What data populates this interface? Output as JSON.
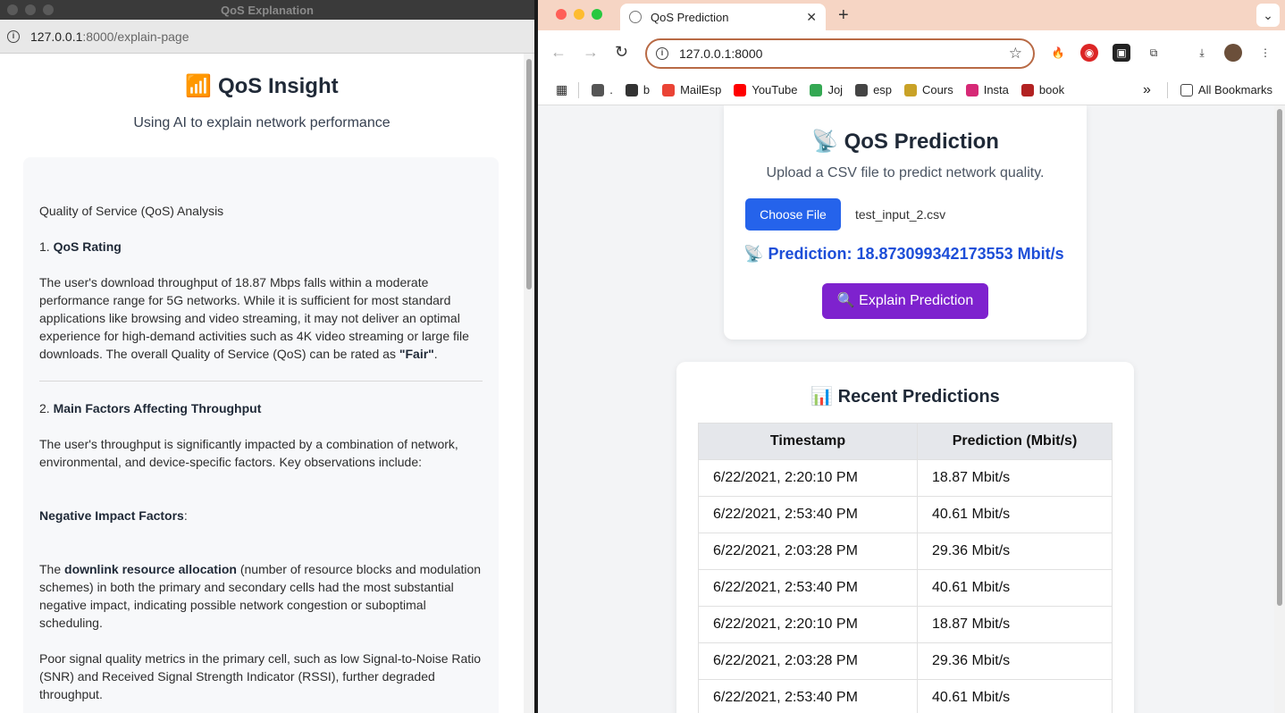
{
  "left_window": {
    "title": "QoS Explanation",
    "url_host": "127.0.0.1",
    "url_path": ":8000/explain-page",
    "heading_icon": "📶",
    "heading": "QoS Insight",
    "subheading": "Using AI to explain network performance",
    "report": {
      "title": "Quality of Service (QoS) Analysis",
      "s1_num": "1. ",
      "s1_title": "QoS Rating",
      "s1_text": "The user's download throughput of 18.87 Mbps falls within a moderate performance range for 5G networks. While it is sufficient for most standard applications like browsing and video streaming, it may not deliver an optimal experience for high-demand activities such as 4K video streaming or large file downloads. The overall Quality of Service (QoS) can be rated as ",
      "s1_rating": "\"Fair\"",
      "s1_end": ".",
      "s2_num": "2. ",
      "s2_title": "Main Factors Affecting Throughput",
      "s2_text": "The user's throughput is significantly impacted by a combination of network, environmental, and device-specific factors. Key observations include:",
      "neg_title": "Negative Impact Factors",
      "neg_colon": ":",
      "p1_pre": "The ",
      "p1_bold": "downlink resource allocation",
      "p1_text": " (number of resource blocks and modulation schemes) in both the primary and secondary cells had the most substantial negative impact, indicating possible network congestion or suboptimal scheduling.",
      "p2_text": "Poor signal quality metrics in the primary cell, such as low Signal-to-Noise Ratio (SNR) and Received Signal Strength Indicator (RSSI), further degraded throughput."
    }
  },
  "right_window": {
    "tab_title": "QoS Prediction",
    "url": "127.0.0.1:8000",
    "bookmarks": [
      {
        "label": ".",
        "color": "#555555"
      },
      {
        "label": "b",
        "color": "#333333"
      },
      {
        "label": "MailEsp",
        "color": "#ea4335"
      },
      {
        "label": "YouTube",
        "color": "#ff0000"
      },
      {
        "label": "Joj",
        "color": "#34a853"
      },
      {
        "label": "esp",
        "color": "#444444"
      },
      {
        "label": "Cours",
        "color": "#c9a227"
      },
      {
        "label": "Insta",
        "color": "#d62976"
      },
      {
        "label": "book",
        "color": "#b22222"
      }
    ],
    "more_bookmarks": "»",
    "all_bookmarks": "All Bookmarks",
    "card": {
      "title_icon": "📡",
      "title": "QoS Prediction",
      "subtitle": "Upload a CSV file to predict network quality.",
      "choose_file": "Choose File",
      "file_name": "test_input_2.csv",
      "prediction_icon": "📡",
      "prediction": "Prediction: 18.873099342173553 Mbit/s",
      "explain_icon": "🔍",
      "explain_label": "Explain Prediction"
    },
    "recent": {
      "title_icon": "📊",
      "title": "Recent Predictions",
      "columns": [
        "Timestamp",
        "Prediction (Mbit/s)"
      ],
      "rows": [
        [
          "6/22/2021, 2:20:10 PM",
          "18.87 Mbit/s"
        ],
        [
          "6/22/2021, 2:53:40 PM",
          "40.61 Mbit/s"
        ],
        [
          "6/22/2021, 2:03:28 PM",
          "29.36 Mbit/s"
        ],
        [
          "6/22/2021, 2:53:40 PM",
          "40.61 Mbit/s"
        ],
        [
          "6/22/2021, 2:20:10 PM",
          "18.87 Mbit/s"
        ],
        [
          "6/22/2021, 2:03:28 PM",
          "29.36 Mbit/s"
        ],
        [
          "6/22/2021, 2:53:40 PM",
          "40.61 Mbit/s"
        ]
      ]
    }
  },
  "colors": {
    "primary_button": "#2563eb",
    "explain_button": "#7e22ce",
    "prediction_text": "#1d4ed8",
    "tabstrip": "#f6d5c4"
  }
}
